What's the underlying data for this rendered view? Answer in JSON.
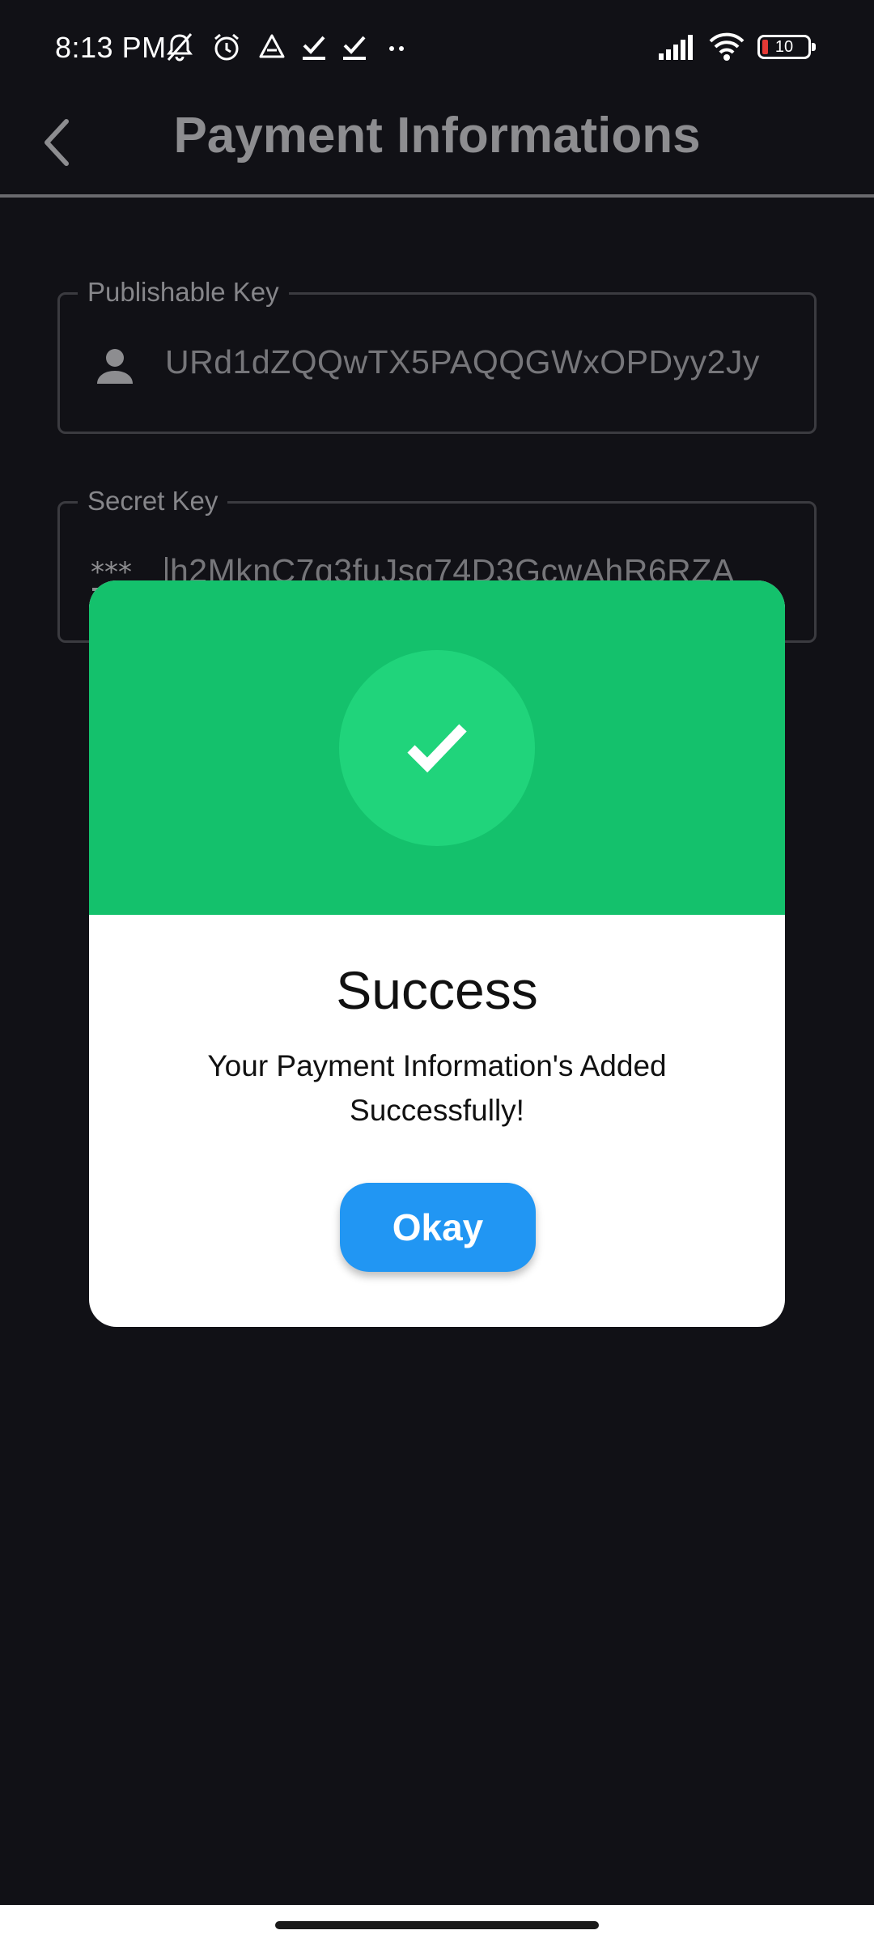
{
  "status_bar": {
    "time": "8:13 PM",
    "battery_level": "10",
    "left_icons": [
      "mute-icon",
      "alarm-icon",
      "drive-icon",
      "check-icon",
      "check-icon",
      "more-dots-icon"
    ],
    "right_icons": [
      "signal-icon",
      "wifi-icon",
      "battery-icon"
    ]
  },
  "app_bar": {
    "title": "Payment Informations",
    "back_icon": "chevron-left-icon"
  },
  "form": {
    "publishable_key": {
      "label": "Publishable Key",
      "value": "URd1dZQQwTX5PAQQGWxOPDyy2Jy",
      "icon": "person-icon"
    },
    "secret_key": {
      "label": "Secret Key",
      "value": "h2MknC7q3fuJsq74D3GcwAhR6RZA",
      "icon": "password-icon"
    }
  },
  "dialog": {
    "title": "Success",
    "message": "Your Payment Information's Added Successfully!",
    "button_label": "Okay",
    "icon": "checkmark-icon"
  },
  "colors": {
    "background": "#111116",
    "success_green": "#14c16c",
    "success_green_light": "#20d47b",
    "button_blue": "#2196f3"
  }
}
